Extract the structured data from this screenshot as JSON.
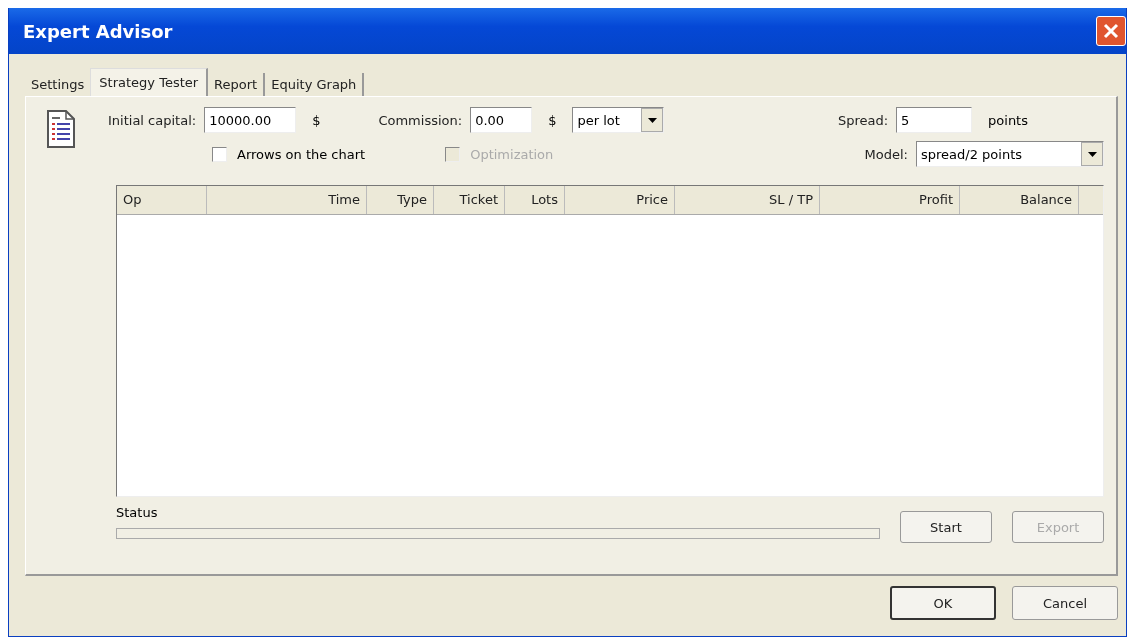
{
  "window": {
    "title": "Expert Advisor"
  },
  "tabs": [
    {
      "label": "Settings",
      "selected": false
    },
    {
      "label": "Strategy Tester",
      "selected": true
    },
    {
      "label": "Report",
      "selected": false
    },
    {
      "label": "Equity Graph",
      "selected": false
    }
  ],
  "capital": {
    "label": "Initial capital:",
    "value": "10000.00",
    "unit": "$"
  },
  "commission": {
    "label": "Commission:",
    "value": "0.00",
    "unit": "$",
    "mode": "per lot"
  },
  "spread": {
    "label": "Spread:",
    "value": "5",
    "unit": "points"
  },
  "model": {
    "label": "Model:",
    "value": "spread/2 points"
  },
  "checkboxes": [
    {
      "label": "Arrows on the chart",
      "checked": false,
      "disabled": false
    },
    {
      "label": "Optimization",
      "checked": false,
      "disabled": true
    }
  ],
  "table": {
    "columns": [
      {
        "label": "Op"
      },
      {
        "label": "Time"
      },
      {
        "label": "Type"
      },
      {
        "label": "Ticket"
      },
      {
        "label": "Lots"
      },
      {
        "label": "Price"
      },
      {
        "label": "SL / TP"
      },
      {
        "label": "Profit"
      },
      {
        "label": "Balance"
      }
    ]
  },
  "status": {
    "label": "Status"
  },
  "buttons": [
    {
      "label": "Start",
      "disabled": false
    },
    {
      "label": "Export",
      "disabled": true
    }
  ],
  "dialog_buttons": [
    {
      "label": "OK",
      "default": true
    },
    {
      "label": "Cancel",
      "default": false
    }
  ]
}
